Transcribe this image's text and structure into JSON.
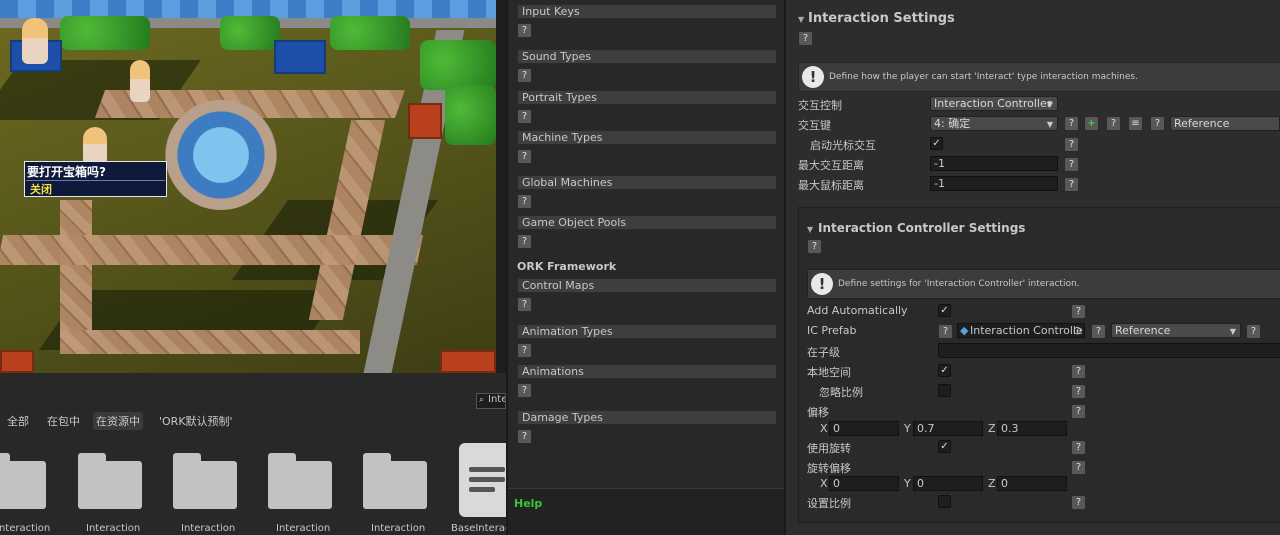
{
  "game": {
    "dialog_question": "要打开宝箱吗?",
    "dialog_option": "关闭"
  },
  "project": {
    "search_value": "Inte",
    "crumbs": [
      "全部",
      "在包中",
      "在资源中",
      "'ORK默认预制'"
    ],
    "files": [
      "Interaction",
      "Interaction",
      "Interaction",
      "Interaction",
      "Interaction",
      "BaseInteracti"
    ]
  },
  "middle": {
    "sections": [
      "Input Keys",
      "Sound Types",
      "Portrait Types",
      "Machine Types",
      "Global Machines",
      "Game Object Pools"
    ],
    "group_label": "ORK Framework",
    "ork_sections": [
      "Control Maps",
      "Animation Types",
      "Animations",
      "Damage Types"
    ],
    "help_label": "Help",
    "q": "?"
  },
  "inspector": {
    "title": "Interaction Settings",
    "info": "Define how the player can start 'Interact' type interaction machines.",
    "rows": {
      "control_label": "交互控制",
      "control_value": "Interaction Controller",
      "key_label": "交互键",
      "key_value": "4: 确定",
      "key_ref": "Reference",
      "cursor_label": "启动光标交互",
      "max_dist_label": "最大交互距离",
      "max_dist_value": "-1",
      "max_mouse_label": "最大鼠标距离",
      "max_mouse_value": "-1"
    },
    "ic": {
      "title": "Interaction Controller Settings",
      "info": "Define settings for 'Interaction Controller' interaction.",
      "add_auto_label": "Add Automatically",
      "prefab_label": "IC Prefab",
      "prefab_value": "Interaction Controlle",
      "prefab_ref": "Reference",
      "child_label": "在子级",
      "local_label": "本地空间",
      "ignore_scale_label": "忽略比例",
      "offset_label": "偏移",
      "offset": {
        "x": "0",
        "y": "0.7",
        "z": "0.3"
      },
      "use_rot_label": "使用旋转",
      "rot_offset_label": "旋转偏移",
      "rot": {
        "x": "0",
        "y": "0",
        "z": "0"
      },
      "set_scale_label": "设置比例",
      "axis": {
        "x": "X",
        "y": "Y",
        "z": "Z"
      }
    }
  }
}
